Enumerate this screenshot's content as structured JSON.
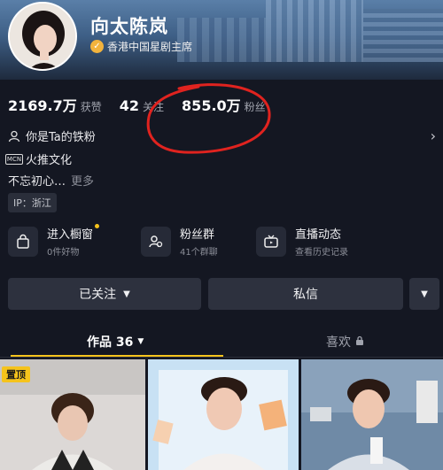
{
  "profile": {
    "name": "向太陈岚",
    "verified_label": "香港中国星剧主席"
  },
  "stats": [
    {
      "value": "2169.7万",
      "label": "获赞"
    },
    {
      "value": "42",
      "label": "关注"
    },
    {
      "value": "855.0万",
      "label": "粉丝"
    }
  ],
  "info": {
    "fan_status": "你是Ta的铁粉",
    "mcn_badge": "MCN",
    "mcn_name": "火推文化",
    "bio": "不忘初心…",
    "bio_more": "更多",
    "ip": "IP：浙江"
  },
  "shortcuts": [
    {
      "title": "进入橱窗",
      "sub": "0件好物",
      "icon": "shopping-bag-icon"
    },
    {
      "title": "粉丝群",
      "sub": "41个群聊",
      "icon": "group-icon"
    },
    {
      "title": "直播动态",
      "sub": "查看历史记录",
      "icon": "live-tv-icon"
    }
  ],
  "actions": {
    "followed": "已关注",
    "message": "私信"
  },
  "tabs": {
    "works": "作品 36",
    "likes": "喜欢"
  },
  "thumbs": {
    "pinned": "置顶"
  },
  "colors": {
    "accent": "#f5c31c",
    "background": "#141722",
    "annotation": "#e0231f"
  }
}
